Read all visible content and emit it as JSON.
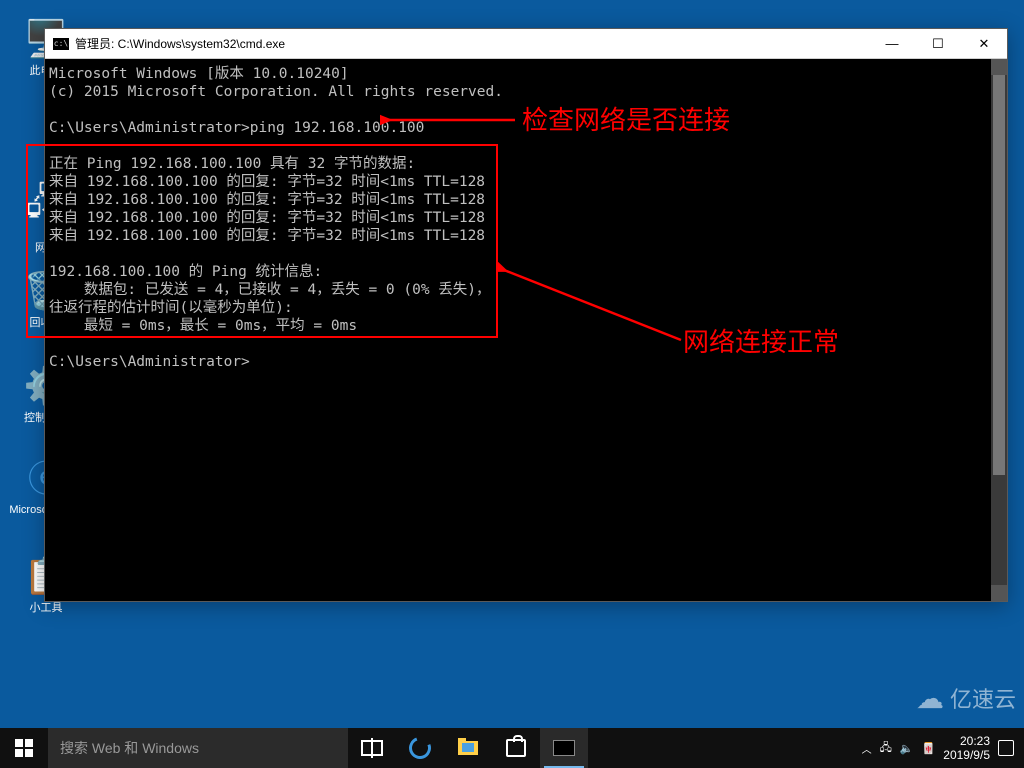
{
  "desktop": {
    "icons": {
      "recycle": "此电脑",
      "network": "网络",
      "recycle2": "回收站",
      "control": "控制面板",
      "edge": "Microsoft Edge",
      "tool": "小工具"
    }
  },
  "window": {
    "title": "管理员: C:\\Windows\\system32\\cmd.exe"
  },
  "cmd": {
    "line1": "Microsoft Windows [版本 10.0.10240]",
    "line2": "(c) 2015 Microsoft Corporation. All rights reserved.",
    "prompt1": "C:\\Users\\Administrator>ping 192.168.100.100",
    "ping_header": "正在 Ping 192.168.100.100 具有 32 字节的数据:",
    "reply1": "来自 192.168.100.100 的回复: 字节=32 时间<1ms TTL=128",
    "reply2": "来自 192.168.100.100 的回复: 字节=32 时间<1ms TTL=128",
    "reply3": "来自 192.168.100.100 的回复: 字节=32 时间<1ms TTL=128",
    "reply4": "来自 192.168.100.100 的回复: 字节=32 时间<1ms TTL=128",
    "stats_header": "192.168.100.100 的 Ping 统计信息:",
    "stats_packets": "    数据包: 已发送 = 4，已接收 = 4，丢失 = 0 (0% 丢失)，",
    "stats_rtt_label": "往返行程的估计时间(以毫秒为单位):",
    "stats_rtt": "    最短 = 0ms，最长 = 0ms，平均 = 0ms",
    "prompt2": "C:\\Users\\Administrator>"
  },
  "annotations": {
    "check": "检查网络是否连接",
    "normal": "网络连接正常"
  },
  "taskbar": {
    "search_placeholder": "搜索 Web 和 Windows"
  },
  "tray": {
    "time": "20:23",
    "date": "2019/9/5"
  },
  "watermark": {
    "text": "亿速云"
  },
  "colors": {
    "annotation": "#ff0000",
    "terminal_bg": "#000000",
    "terminal_fg": "#c0c0c0",
    "desktop_bg": "#0a5a9e"
  }
}
